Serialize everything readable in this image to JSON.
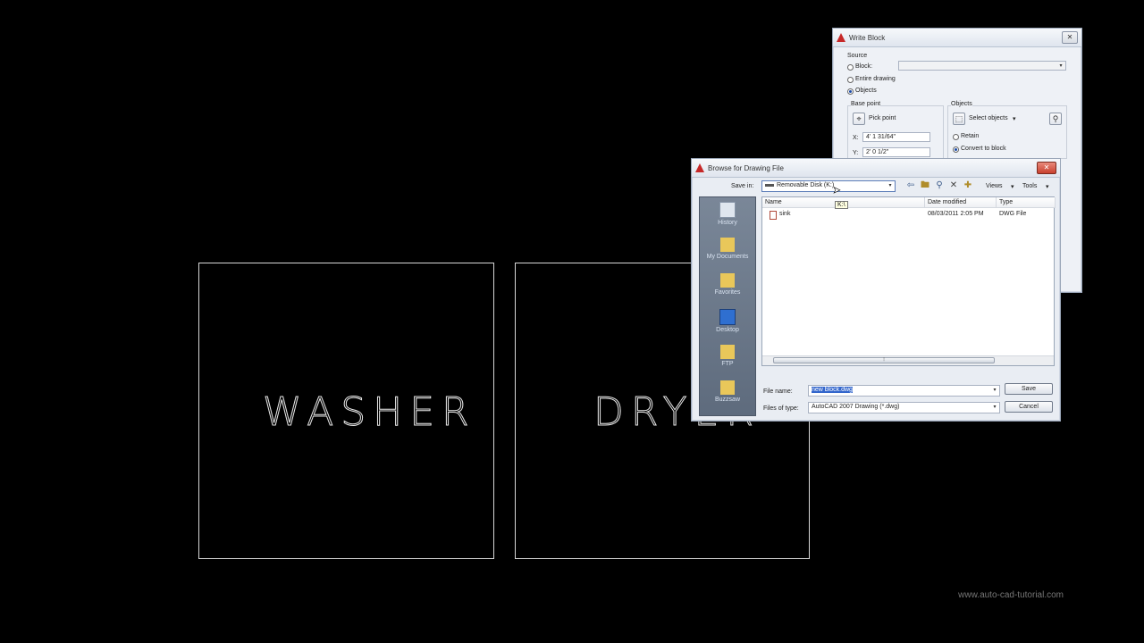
{
  "canvas": {
    "washer_text": "WASHER",
    "dryer_text": "DRYER",
    "watermark": "www.auto-cad-tutorial.com"
  },
  "write_block": {
    "title": "Write Block",
    "source_label": "Source",
    "opt_block": "Block:",
    "opt_entire": "Entire drawing",
    "opt_objects": "Objects",
    "base_point_label": "Base point",
    "pick_point": "Pick point",
    "x_label": "X:",
    "x_value": "4' 1 31/64\"",
    "y_label": "Y:",
    "y_value": "2' 0 1/2\"",
    "objects_label": "Objects",
    "select_objects": "Select objects",
    "retain": "Retain",
    "convert": "Convert to block"
  },
  "browse": {
    "title": "Browse for Drawing File",
    "save_in_label": "Save in:",
    "save_in_value": "Removable Disk (K:)",
    "tooltip": "K:\\",
    "views_label": "Views",
    "tools_label": "Tools",
    "places": [
      "History",
      "My Documents",
      "Favorites",
      "Desktop",
      "FTP",
      "Buzzsaw"
    ],
    "columns": {
      "name": "Name",
      "date": "Date modified",
      "type": "Type"
    },
    "files": [
      {
        "name": "sink",
        "date": "08/03/2011 2:05 PM",
        "type": "DWG File"
      }
    ],
    "file_name_label": "File name:",
    "file_name_value": "new block.dwg",
    "file_type_label": "Files of type:",
    "file_type_value": "AutoCAD 2007 Drawing (*.dwg)",
    "save_btn": "Save",
    "cancel_btn": "Cancel"
  }
}
